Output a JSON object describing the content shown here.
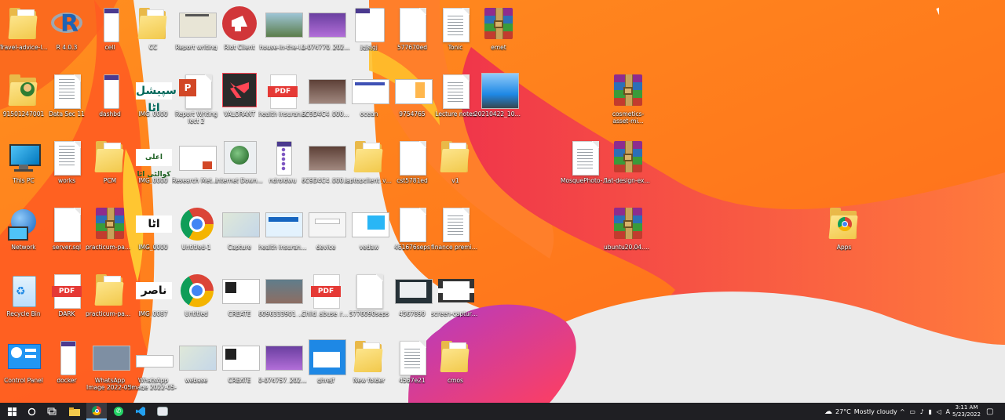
{
  "desktop_icons": [
    {
      "label": "Travel-advice-list",
      "kind": "folder"
    },
    {
      "label": "R 4.0.3",
      "kind": "r"
    },
    {
      "label": "cell",
      "kind": "phone"
    },
    {
      "label": "CC",
      "kind": "folder"
    },
    {
      "label": "Report writing",
      "kind": "thumb-report"
    },
    {
      "label": "Riot Client",
      "kind": "riot"
    },
    {
      "label": "house-in-the-l...",
      "kind": "photo"
    },
    {
      "label": "0-074770_2021...",
      "kind": "photo-purple"
    },
    {
      "label": "jgjsjgj",
      "kind": "phone-list"
    },
    {
      "label": "577670ed",
      "kind": "doc"
    },
    {
      "label": "Tonic",
      "kind": "doc-lines"
    },
    {
      "label": "emet",
      "kind": "rar"
    },
    {
      "label": "91501247001",
      "kind": "user-folder"
    },
    {
      "label": "Data Sec 11",
      "kind": "thumb-doc"
    },
    {
      "label": "dashbd",
      "kind": "phone"
    },
    {
      "label": "IMG_0000",
      "kind": "arabic1"
    },
    {
      "label": "Report Writing lect 2",
      "kind": "ppt"
    },
    {
      "label": "VALORANT",
      "kind": "valorant"
    },
    {
      "label": "health insurance",
      "kind": "pdf"
    },
    {
      "label": "6C9D4C4_0001...",
      "kind": "photo-dark"
    },
    {
      "label": "ocean",
      "kind": "thumb-web"
    },
    {
      "label": "9754765",
      "kind": "thumb-web2"
    },
    {
      "label": "Lecture notes",
      "kind": "doc-lines"
    },
    {
      "label": "20210422_1023...",
      "kind": "photo-person"
    },
    {
      "label": "cosmetics-asset-mi...",
      "kind": "rar"
    },
    {
      "label": "This PC",
      "kind": "pc"
    },
    {
      "label": "works",
      "kind": "thumb-doc"
    },
    {
      "label": "PCM",
      "kind": "folder"
    },
    {
      "label": "IMG_0000",
      "kind": "arabic2"
    },
    {
      "label": "Research Methods",
      "kind": "thumb-research"
    },
    {
      "label": "Internet Downlo...",
      "kind": "idm"
    },
    {
      "label": "ndroidwu",
      "kind": "phone-dots"
    },
    {
      "label": "6C9D4C4_0001...",
      "kind": "photo-dark"
    },
    {
      "label": "laptopclient_v2...",
      "kind": "folder"
    },
    {
      "label": "cst5781ed",
      "kind": "doc"
    },
    {
      "label": "v1",
      "kind": "folder"
    },
    {
      "label": "MosquePhoto-Pe...",
      "kind": "doc-lines"
    },
    {
      "label": "flat-design-exhi...",
      "kind": "rar"
    },
    {
      "label": "Network",
      "kind": "network"
    },
    {
      "label": "server.sql",
      "kind": "doc"
    },
    {
      "label": "practicum-pane...",
      "kind": "rar"
    },
    {
      "label": "IMG_0000",
      "kind": "arabic3"
    },
    {
      "label": "Untitled-1",
      "kind": "chrome"
    },
    {
      "label": "Capture",
      "kind": "thumb-map"
    },
    {
      "label": "health insurance",
      "kind": "thumb-health"
    },
    {
      "label": "device",
      "kind": "thumb-google"
    },
    {
      "label": "vedaw",
      "kind": "thumb-vedaw"
    },
    {
      "label": "461676seps",
      "kind": "doc"
    },
    {
      "label": "finance premium",
      "kind": "doc-lines"
    },
    {
      "label": "ubuntu20.04.1-pra...",
      "kind": "rar"
    },
    {
      "label": "Apps",
      "kind": "chrome-folder"
    },
    {
      "label": "Recycle Bin",
      "kind": "recycle"
    },
    {
      "label": "DARK",
      "kind": "pdf"
    },
    {
      "label": "practicum-pane...",
      "kind": "folder"
    },
    {
      "label": "IMG_0087",
      "kind": "arabic4"
    },
    {
      "label": "Untitled",
      "kind": "chrome"
    },
    {
      "label": "CREATE",
      "kind": "thumb-create"
    },
    {
      "label": "6096333901_113...",
      "kind": "photo-building"
    },
    {
      "label": "Child_abuse_rep...",
      "kind": "pdf"
    },
    {
      "label": "5776090seps",
      "kind": "doc"
    },
    {
      "label": "4567890",
      "kind": "thumb-store"
    },
    {
      "label": "screen-capture (1)",
      "kind": "video"
    },
    {
      "label": "Control Panel",
      "kind": "control"
    },
    {
      "label": "docker",
      "kind": "phone"
    },
    {
      "label": "WhatsApp Image 2022-05-17 at ...",
      "kind": "thumb-whatsapp"
    },
    {
      "label": "WhatsApp Image 2022-05-16 at ...",
      "kind": "thumb-white"
    },
    {
      "label": "webase",
      "kind": "thumb-map"
    },
    {
      "label": "CREATE",
      "kind": "thumb-create"
    },
    {
      "label": "0-074757_2021...",
      "kind": "photo-purple"
    },
    {
      "label": "ghrejf",
      "kind": "thumb-blue"
    },
    {
      "label": "New folder",
      "kind": "folder"
    },
    {
      "label": "4567e21",
      "kind": "doc-lines"
    },
    {
      "label": "cmos",
      "kind": "folder"
    }
  ],
  "taskbar": {
    "weather_temp": "27°C",
    "weather_text": "Mostly cloudy",
    "time": "3:11 AM",
    "date": "5/23/2022"
  },
  "colors": {
    "taskbar": "#1f1f23",
    "wallpaper": "#f7821c"
  }
}
